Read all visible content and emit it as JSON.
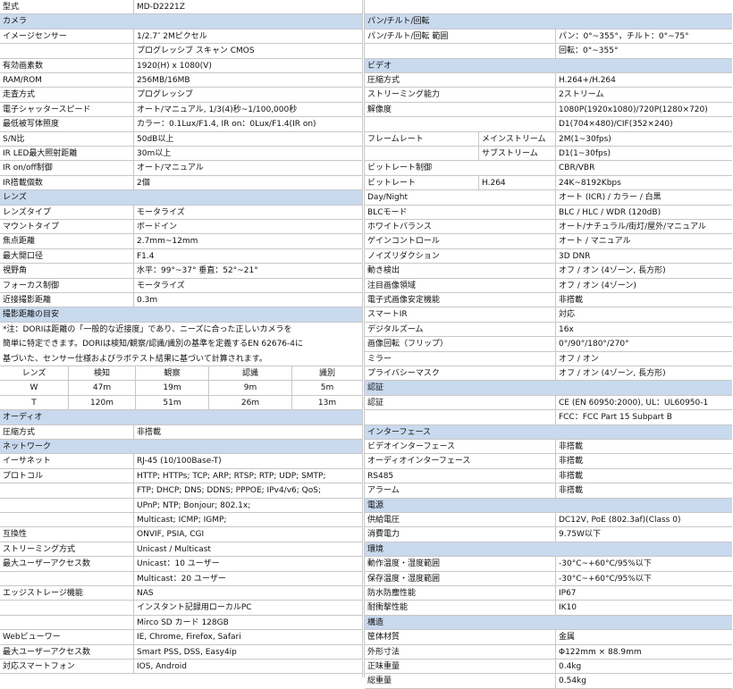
{
  "left": [
    {
      "type": "pair",
      "label": "型式",
      "value": "MD-D2221Z"
    },
    {
      "type": "header",
      "label": "カメラ"
    },
    {
      "type": "pair",
      "label": "イメージセンサー",
      "value": "1/2.7″ 2Mピクセル"
    },
    {
      "type": "pair",
      "label": "",
      "value": "プログレッシブ スキャン CMOS"
    },
    {
      "type": "pair",
      "label": "有効画素数",
      "value": "1920(H) x 1080(V)"
    },
    {
      "type": "pair",
      "label": "RAM/ROM",
      "value": "256MB/16MB"
    },
    {
      "type": "pair",
      "label": "走査方式",
      "value": "プログレッシブ"
    },
    {
      "type": "pair",
      "label": "電子シャッタースピード",
      "value": "オート/マニュアル, 1/3(4)秒~1/100,000秒"
    },
    {
      "type": "pair",
      "label": "最低被写体照度",
      "value": "カラー：0.1Lux/F1.4, IR on：0Lux/F1.4(IR on)"
    },
    {
      "type": "pair",
      "label": "S/N比",
      "value": "50dB以上"
    },
    {
      "type": "pair",
      "label": "IR LED最大照射距離",
      "value": "30m以上"
    },
    {
      "type": "pair",
      "label": "IR on/off制御",
      "value": "オート/マニュアル"
    },
    {
      "type": "pair",
      "label": "IR搭載個数",
      "value": "2個"
    },
    {
      "type": "header",
      "label": "レンズ"
    },
    {
      "type": "pair",
      "label": "レンズタイプ",
      "value": "モータライズ"
    },
    {
      "type": "pair",
      "label": "マウントタイプ",
      "value": "ボードイン"
    },
    {
      "type": "pair",
      "label": "焦点距離",
      "value": "2.7mm~12mm"
    },
    {
      "type": "pair",
      "label": "最大開口径",
      "value": "F1.4"
    },
    {
      "type": "pair",
      "label": "視野角",
      "value": "水平：99°~37° 垂直：52°~21°"
    },
    {
      "type": "pair",
      "label": "フォーカス制御",
      "value": "モータライズ"
    },
    {
      "type": "pair",
      "label": "近接撮影距離",
      "value": "0.3m"
    },
    {
      "type": "header",
      "label": "撮影距離の目安"
    },
    {
      "type": "note",
      "lines": [
        "*注：DORIは距離の「一般的な近接度」であり、ニーズに合った正しいカメラを",
        "簡単に特定できます。DORIは検知/観察/認識/識別の基準を定義するEN 62676-4に",
        "基づいた、センサー仕様およびラボテスト結果に基づいて計算されます。"
      ]
    },
    {
      "type": "dori",
      "cells": [
        "レンズ",
        "検知",
        "観察",
        "認識",
        "識別"
      ]
    },
    {
      "type": "dori",
      "cells": [
        "W",
        "47m",
        "19m",
        "9m",
        "5m"
      ]
    },
    {
      "type": "dori",
      "cells": [
        "T",
        "120m",
        "51m",
        "26m",
        "13m"
      ]
    },
    {
      "type": "header",
      "label": "オーディオ"
    },
    {
      "type": "pair",
      "label": "圧縮方式",
      "value": "非搭載"
    },
    {
      "type": "header",
      "label": "ネットワーク"
    },
    {
      "type": "pair",
      "label": "イーサネット",
      "value": "RJ-45 (10/100Base-T)"
    },
    {
      "type": "pair",
      "label": "プロトコル",
      "value": "HTTP; HTTPs; TCP; ARP; RTSP; RTP; UDP; SMTP;"
    },
    {
      "type": "pair",
      "label": "",
      "value": "FTP; DHCP; DNS; DDNS; PPPOE; IPv4/v6; QoS;"
    },
    {
      "type": "pair",
      "label": "",
      "value": "UPnP; NTP; Bonjour; 802.1x;"
    },
    {
      "type": "pair",
      "label": "",
      "value": "Multicast; ICMP; IGMP;"
    },
    {
      "type": "pair",
      "label": "互換性",
      "value": "ONVIF, PSIA, CGI"
    },
    {
      "type": "pair",
      "label": "ストリーミング方式",
      "value": "Unicast / Multicast"
    },
    {
      "type": "pair",
      "label": "最大ユーザーアクセス数",
      "value": "Unicast：10 ユーザー"
    },
    {
      "type": "pair",
      "label": "",
      "value": "Multicast：20 ユーザー"
    },
    {
      "type": "pair",
      "label": "エッジストレージ機能",
      "value": "NAS"
    },
    {
      "type": "pair",
      "label": "",
      "value": "インスタント記録用ローカルPC"
    },
    {
      "type": "pair",
      "label": "",
      "value": "Mirco SD カード 128GB"
    },
    {
      "type": "pair",
      "label": "Webビューワー",
      "value": "IE, Chrome, Firefox, Safari"
    },
    {
      "type": "pair",
      "label": "最大ユーザーアクセス数",
      "value": "Smart PSS, DSS, Easy4ip"
    },
    {
      "type": "pair",
      "label": "対応スマートフォン",
      "value": "IOS, Android"
    }
  ],
  "right": [
    {
      "type": "blank"
    },
    {
      "type": "header",
      "label": "パン/チルト/回転"
    },
    {
      "type": "pair",
      "label": "パン/チルト/回転 範囲",
      "value": "パン：0°~355°，チルト：0°~75°"
    },
    {
      "type": "pair",
      "label": "",
      "value": "回転：0°~355°"
    },
    {
      "type": "header",
      "label": "ビデオ"
    },
    {
      "type": "pair",
      "label": "圧縮方式",
      "value": "H.264+/H.264"
    },
    {
      "type": "pair",
      "label": "ストリーミング能力",
      "value": "2ストリーム"
    },
    {
      "type": "pair",
      "label": "解像度",
      "value": "1080P(1920x1080)/720P(1280×720)"
    },
    {
      "type": "pair",
      "label": "",
      "value": "D1(704×480)/CIF(352×240)"
    },
    {
      "type": "triple",
      "label": "フレームレート",
      "sub": "メインストリーム",
      "value": "2M(1~30fps)"
    },
    {
      "type": "triple",
      "label": "",
      "sub": "サブストリーム",
      "value": "D1(1~30fps)"
    },
    {
      "type": "pair",
      "label": "ビットレート制御",
      "value": "CBR/VBR"
    },
    {
      "type": "triple",
      "label": "ビットレート",
      "sub": "H.264",
      "value": "24K~8192Kbps"
    },
    {
      "type": "pair",
      "label": "Day/Night",
      "value": "オート (ICR) / カラー / 白黒"
    },
    {
      "type": "pair",
      "label": "BLCモード",
      "value": "BLC / HLC / WDR (120dB)"
    },
    {
      "type": "pair",
      "label": "ホワイトバランス",
      "value": "オート/ナチュラル/街灯/屋外/マニュアル"
    },
    {
      "type": "pair",
      "label": "ゲインコントロール",
      "value": "オート / マニュアル"
    },
    {
      "type": "pair",
      "label": "ノイズリダクション",
      "value": "3D DNR"
    },
    {
      "type": "pair",
      "label": "動き検出",
      "value": "オフ / オン (4ゾーン, 長方形)"
    },
    {
      "type": "pair",
      "label": "注目画像領域",
      "value": "オフ / オン (4ゾーン)"
    },
    {
      "type": "pair",
      "label": "電子式画像安定機能",
      "value": "非搭載"
    },
    {
      "type": "pair",
      "label": "スマートIR",
      "value": "対応"
    },
    {
      "type": "pair",
      "label": "デジタルズーム",
      "value": "16x"
    },
    {
      "type": "pair",
      "label": "画像回転（フリップ）",
      "value": "0°/90°/180°/270°"
    },
    {
      "type": "pair",
      "label": "ミラー",
      "value": "オフ / オン"
    },
    {
      "type": "pair",
      "label": "プライバシーマスク",
      "value": "オフ / オン (4ゾーン, 長方形)"
    },
    {
      "type": "header",
      "label": "認証"
    },
    {
      "type": "pair",
      "label": "認証",
      "value": "CE (EN 60950:2000), UL：UL60950-1"
    },
    {
      "type": "pair",
      "label": "",
      "value": "FCC：FCC Part 15 Subpart B"
    },
    {
      "type": "header",
      "label": "インターフェース"
    },
    {
      "type": "pair",
      "label": "ビデオインターフェース",
      "value": "非搭載"
    },
    {
      "type": "pair",
      "label": "オーディオインターフェース",
      "value": "非搭載"
    },
    {
      "type": "pair",
      "label": "RS485",
      "value": "非搭載"
    },
    {
      "type": "pair",
      "label": "アラーム",
      "value": "非搭載"
    },
    {
      "type": "header",
      "label": "電源"
    },
    {
      "type": "pair",
      "label": "供給電圧",
      "value": "DC12V, PoE (802.3af)(Class 0)"
    },
    {
      "type": "pair",
      "label": "消費電力",
      "value": "9.75W以下"
    },
    {
      "type": "header",
      "label": "環境"
    },
    {
      "type": "pair",
      "label": "動作温度・湿度範囲",
      "value": "-30°C~+60°C/95%以下"
    },
    {
      "type": "pair",
      "label": "保存温度・湿度範囲",
      "value": "-30°C~+60°C/95%以下"
    },
    {
      "type": "pair",
      "label": "防水防塵性能",
      "value": "IP67"
    },
    {
      "type": "pair",
      "label": "耐衝撃性能",
      "value": "IK10"
    },
    {
      "type": "header",
      "label": "構造"
    },
    {
      "type": "pair",
      "label": "筐体材質",
      "value": "金属"
    },
    {
      "type": "pair",
      "label": "外形寸法",
      "value": "Φ122mm × 88.9mm"
    },
    {
      "type": "pair",
      "label": "正味重量",
      "value": "0.4kg"
    },
    {
      "type": "pair",
      "label": "総重量",
      "value": "0.54kg"
    }
  ]
}
